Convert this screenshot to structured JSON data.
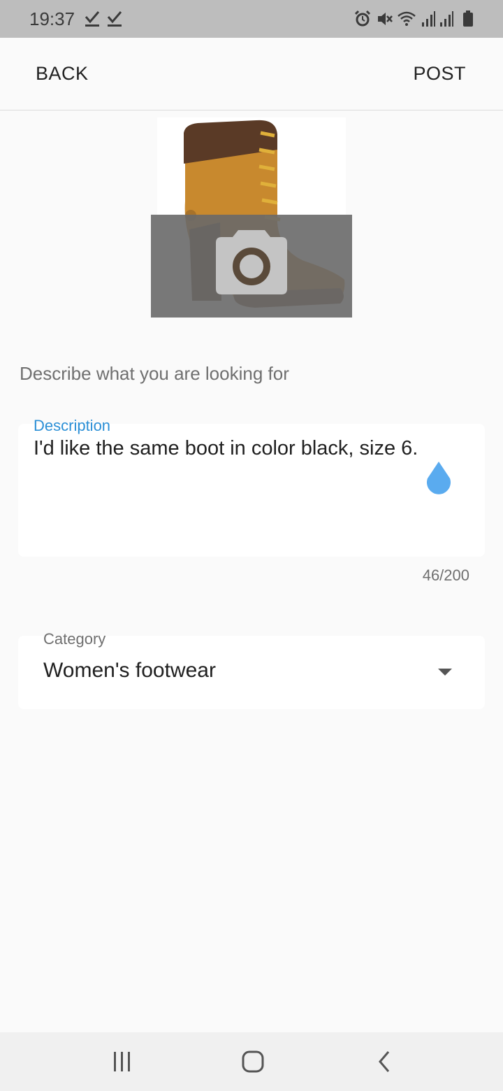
{
  "status_bar": {
    "time": "19:37",
    "left_icons": [
      "check-download-icon",
      "check-download-icon"
    ],
    "right_icons": [
      "alarm-icon",
      "mute-icon",
      "wifi-icon",
      "signal-icon",
      "signal-icon",
      "battery-icon"
    ]
  },
  "app_bar": {
    "back_label": "BACK",
    "post_label": "POST"
  },
  "photo": {
    "icon": "camera-icon"
  },
  "prompt": "Describe what you are looking for",
  "description": {
    "label": "Description",
    "value": "I'd like the same boot in color black, size 6.",
    "counter": "46/200"
  },
  "category": {
    "label": "Category",
    "value": "Women's footwear"
  },
  "colors": {
    "accent": "#2b8fd6",
    "cursor_handle": "#5aabef",
    "status_bar": "#bdbdbd"
  },
  "nav_bar": {
    "icons": [
      "recent-apps-icon",
      "home-icon",
      "back-icon"
    ]
  }
}
